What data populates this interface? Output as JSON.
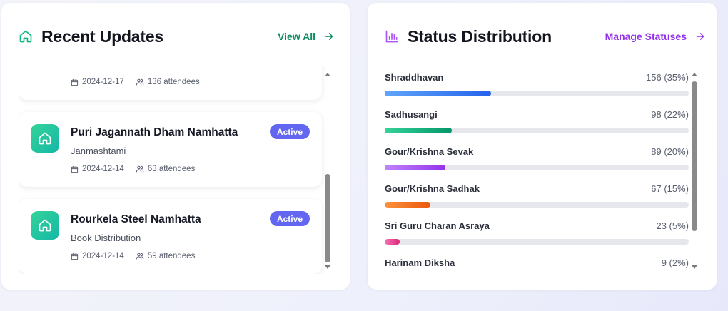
{
  "recent_updates": {
    "title": "Recent Updates",
    "view_all_label": "View All",
    "items": [
      {
        "name": "",
        "subtitle": "",
        "date": "2024-12-17",
        "attendees": "136 attendees",
        "status": ""
      },
      {
        "name": "Puri Jagannath Dham Namhatta",
        "subtitle": "Janmashtami",
        "date": "2024-12-14",
        "attendees": "63 attendees",
        "status": "Active"
      },
      {
        "name": "Rourkela Steel Namhatta",
        "subtitle": "Book Distribution",
        "date": "2024-12-14",
        "attendees": "59 attendees",
        "status": "Active"
      }
    ]
  },
  "status_distribution": {
    "title": "Status Distribution",
    "manage_label": "Manage Statuses",
    "items": [
      {
        "label": "Shraddhavan",
        "value": "156 (35%)",
        "percent": 35,
        "color_from": "#60a5fa",
        "color_to": "#2563eb"
      },
      {
        "label": "Sadhusangi",
        "value": "98 (22%)",
        "percent": 22,
        "color_from": "#34d399",
        "color_to": "#059669"
      },
      {
        "label": "Gour/Krishna Sevak",
        "value": "89 (20%)",
        "percent": 20,
        "color_from": "#c084fc",
        "color_to": "#9333ea"
      },
      {
        "label": "Gour/Krishna Sadhak",
        "value": "67 (15%)",
        "percent": 15,
        "color_from": "#fb923c",
        "color_to": "#ea580c"
      },
      {
        "label": "Sri Guru Charan Asraya",
        "value": "23 (5%)",
        "percent": 5,
        "color_from": "#f472b6",
        "color_to": "#db2777"
      },
      {
        "label": "Harinam Diksha",
        "value": "9 (2%)",
        "percent": 2,
        "color_from": "#94a3b8",
        "color_to": "#475569"
      }
    ]
  },
  "colors": {
    "accent_green": "#0f8a63",
    "accent_purple": "#9333ea",
    "badge_indigo": "#6366f1"
  },
  "icons": {
    "updates_title": "home-icon",
    "status_title": "bar-chart-icon",
    "item": "home-icon",
    "date": "calendar-icon",
    "attendees": "users-icon",
    "link": "arrow-right-icon"
  }
}
